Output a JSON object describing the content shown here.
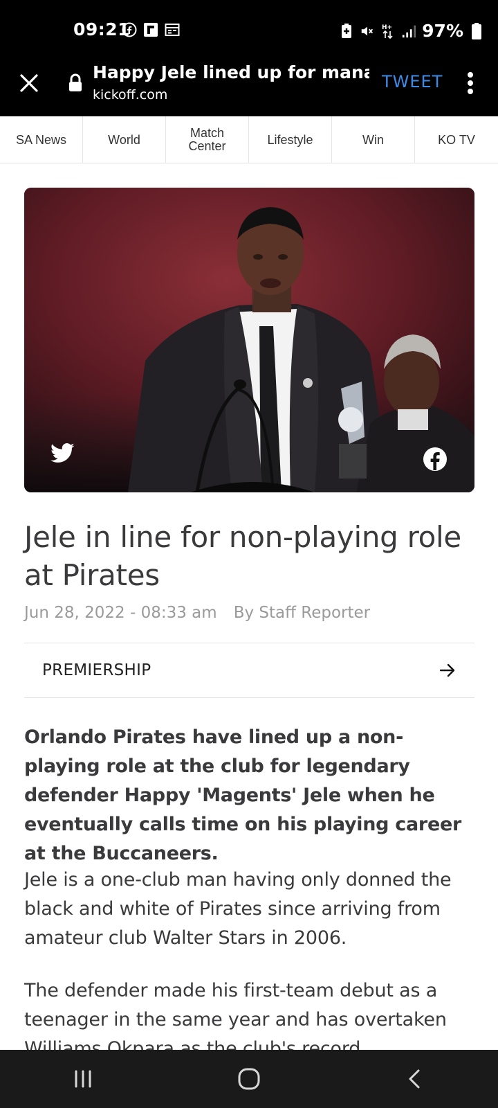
{
  "status_bar": {
    "time": "09:21",
    "battery": "97%",
    "icons_left": [
      "facebook-icon",
      "flipboard-icon",
      "calendar-icon"
    ],
    "icons_right": [
      "battery-saver-icon",
      "mute-icon",
      "data-arrows-icon",
      "signal-icon",
      "battery-icon"
    ]
  },
  "browser": {
    "page_title": "Happy Jele lined up for manag...",
    "domain": "kickoff.com",
    "tweet_label": "TWEET",
    "accent_color": "#3d8be6"
  },
  "nav": {
    "categories": [
      {
        "label": "SA News"
      },
      {
        "label": "World"
      },
      {
        "label": "Match\nCenter"
      },
      {
        "label": "Lifestyle"
      },
      {
        "label": "Win"
      },
      {
        "label": "KO TV"
      }
    ]
  },
  "article": {
    "headline": "Jele in line for non-playing role at Pirates",
    "date": "Jun 28, 2022 - 08:33 am",
    "author": "By Staff Reporter",
    "section": "PREMIERSHIP",
    "lead": "Orlando Pirates have lined up a non-playing role at the club for legendary defender Happy 'Magents' Jele when he eventually calls time on his playing career at the Buccaneers.",
    "paragraphs": [
      "Jele is a one-club man having only donned the black and white of Pirates since arriving from amateur club Walter Stars in 2006.",
      "The defender made his first-team debut as a teenager in the same year and has overtaken Williams Okpara as the club's record"
    ]
  }
}
